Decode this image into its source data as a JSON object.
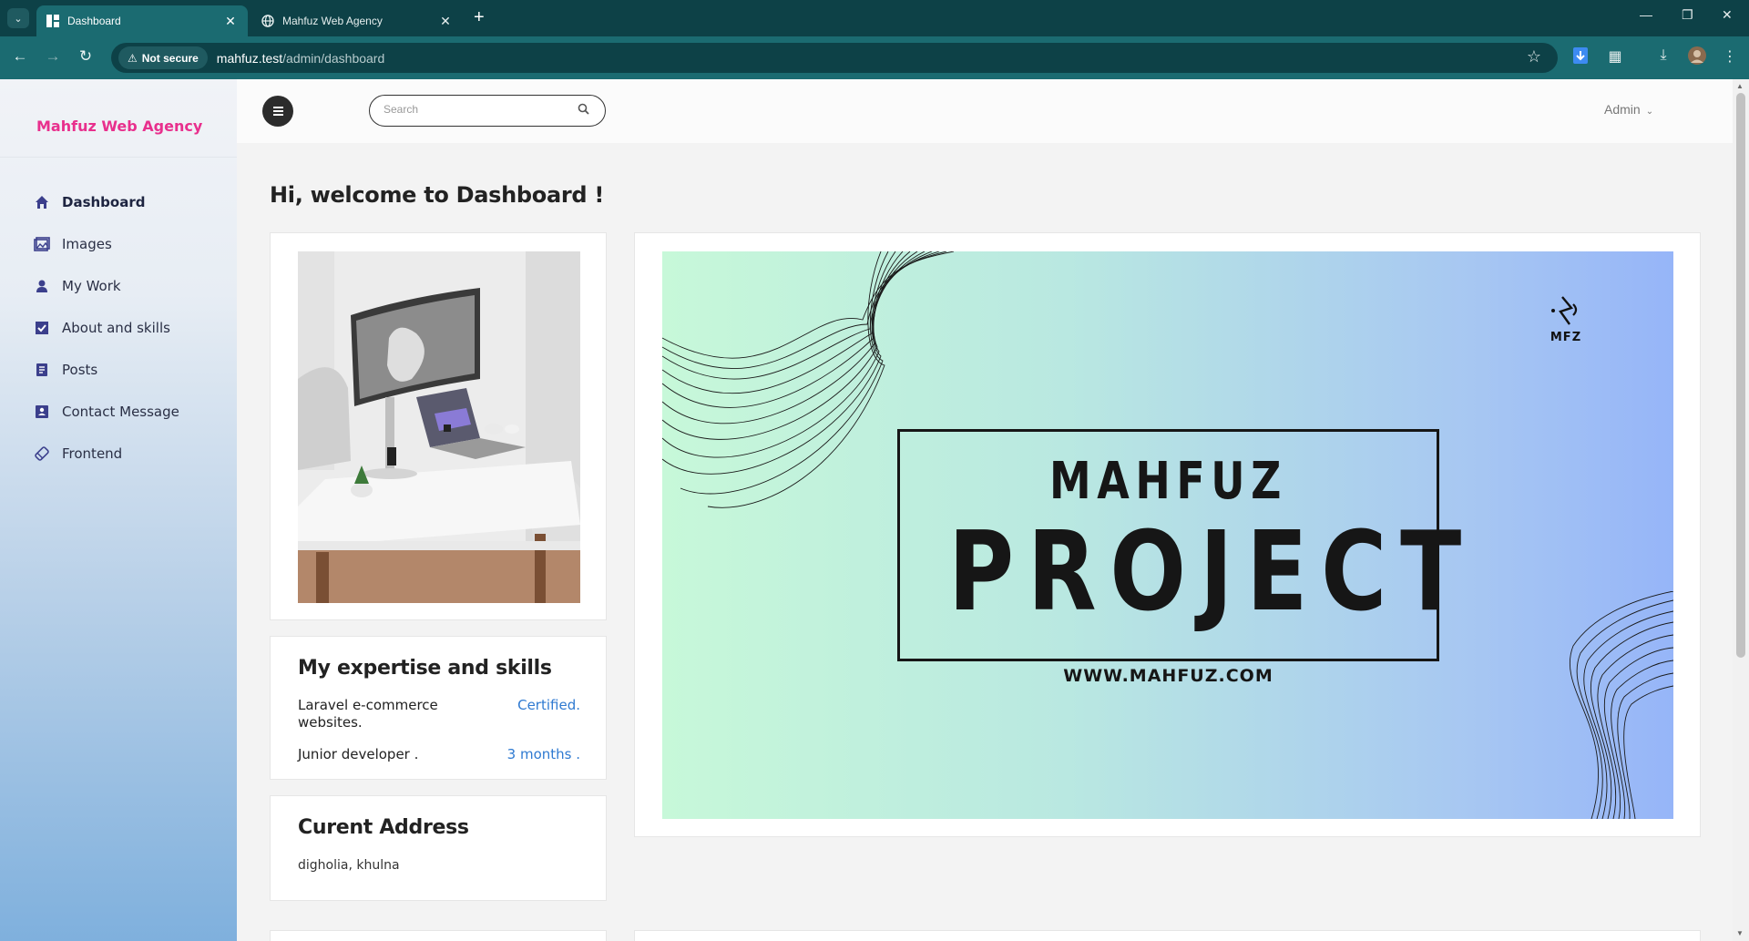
{
  "browser": {
    "tabs": [
      {
        "title": "Dashboard",
        "active": true
      },
      {
        "title": "Mahfuz Web Agency",
        "active": false
      }
    ],
    "security_label": "Not secure",
    "url_host": "mahfuz.test",
    "url_path": "/admin/dashboard"
  },
  "sidebar": {
    "brand": "Mahfuz Web Agency",
    "items": [
      {
        "label": "Dashboard",
        "icon": "home-icon"
      },
      {
        "label": "Images",
        "icon": "images-icon"
      },
      {
        "label": "My Work",
        "icon": "user-icon"
      },
      {
        "label": "About and skills",
        "icon": "check-square-icon"
      },
      {
        "label": "Posts",
        "icon": "document-icon"
      },
      {
        "label": "Contact Message",
        "icon": "contact-card-icon"
      },
      {
        "label": "Frontend",
        "icon": "frontend-icon"
      }
    ]
  },
  "header": {
    "search_placeholder": "Search",
    "user_label": "Admin"
  },
  "main": {
    "welcome": "Hi, welcome to Dashboard !",
    "skills": {
      "title": "My expertise and skills",
      "rows": [
        {
          "name": "Laravel e-commerce websites.",
          "value": "Certified."
        },
        {
          "name": "Junior developer .",
          "value": "3 months ."
        }
      ]
    },
    "address": {
      "title": "Curent Address",
      "text": "digholia, khulna"
    },
    "banner": {
      "logo_text": "MFZ",
      "title_top": "MAHFUZ",
      "title_main": "PROJECT",
      "website": "WWW.MAHFUZ.COM"
    }
  },
  "colors": {
    "brand": "#e8308d",
    "link": "#2f7ad1",
    "browser_dark": "#0d4147",
    "browser_mid": "#1b6b71"
  }
}
